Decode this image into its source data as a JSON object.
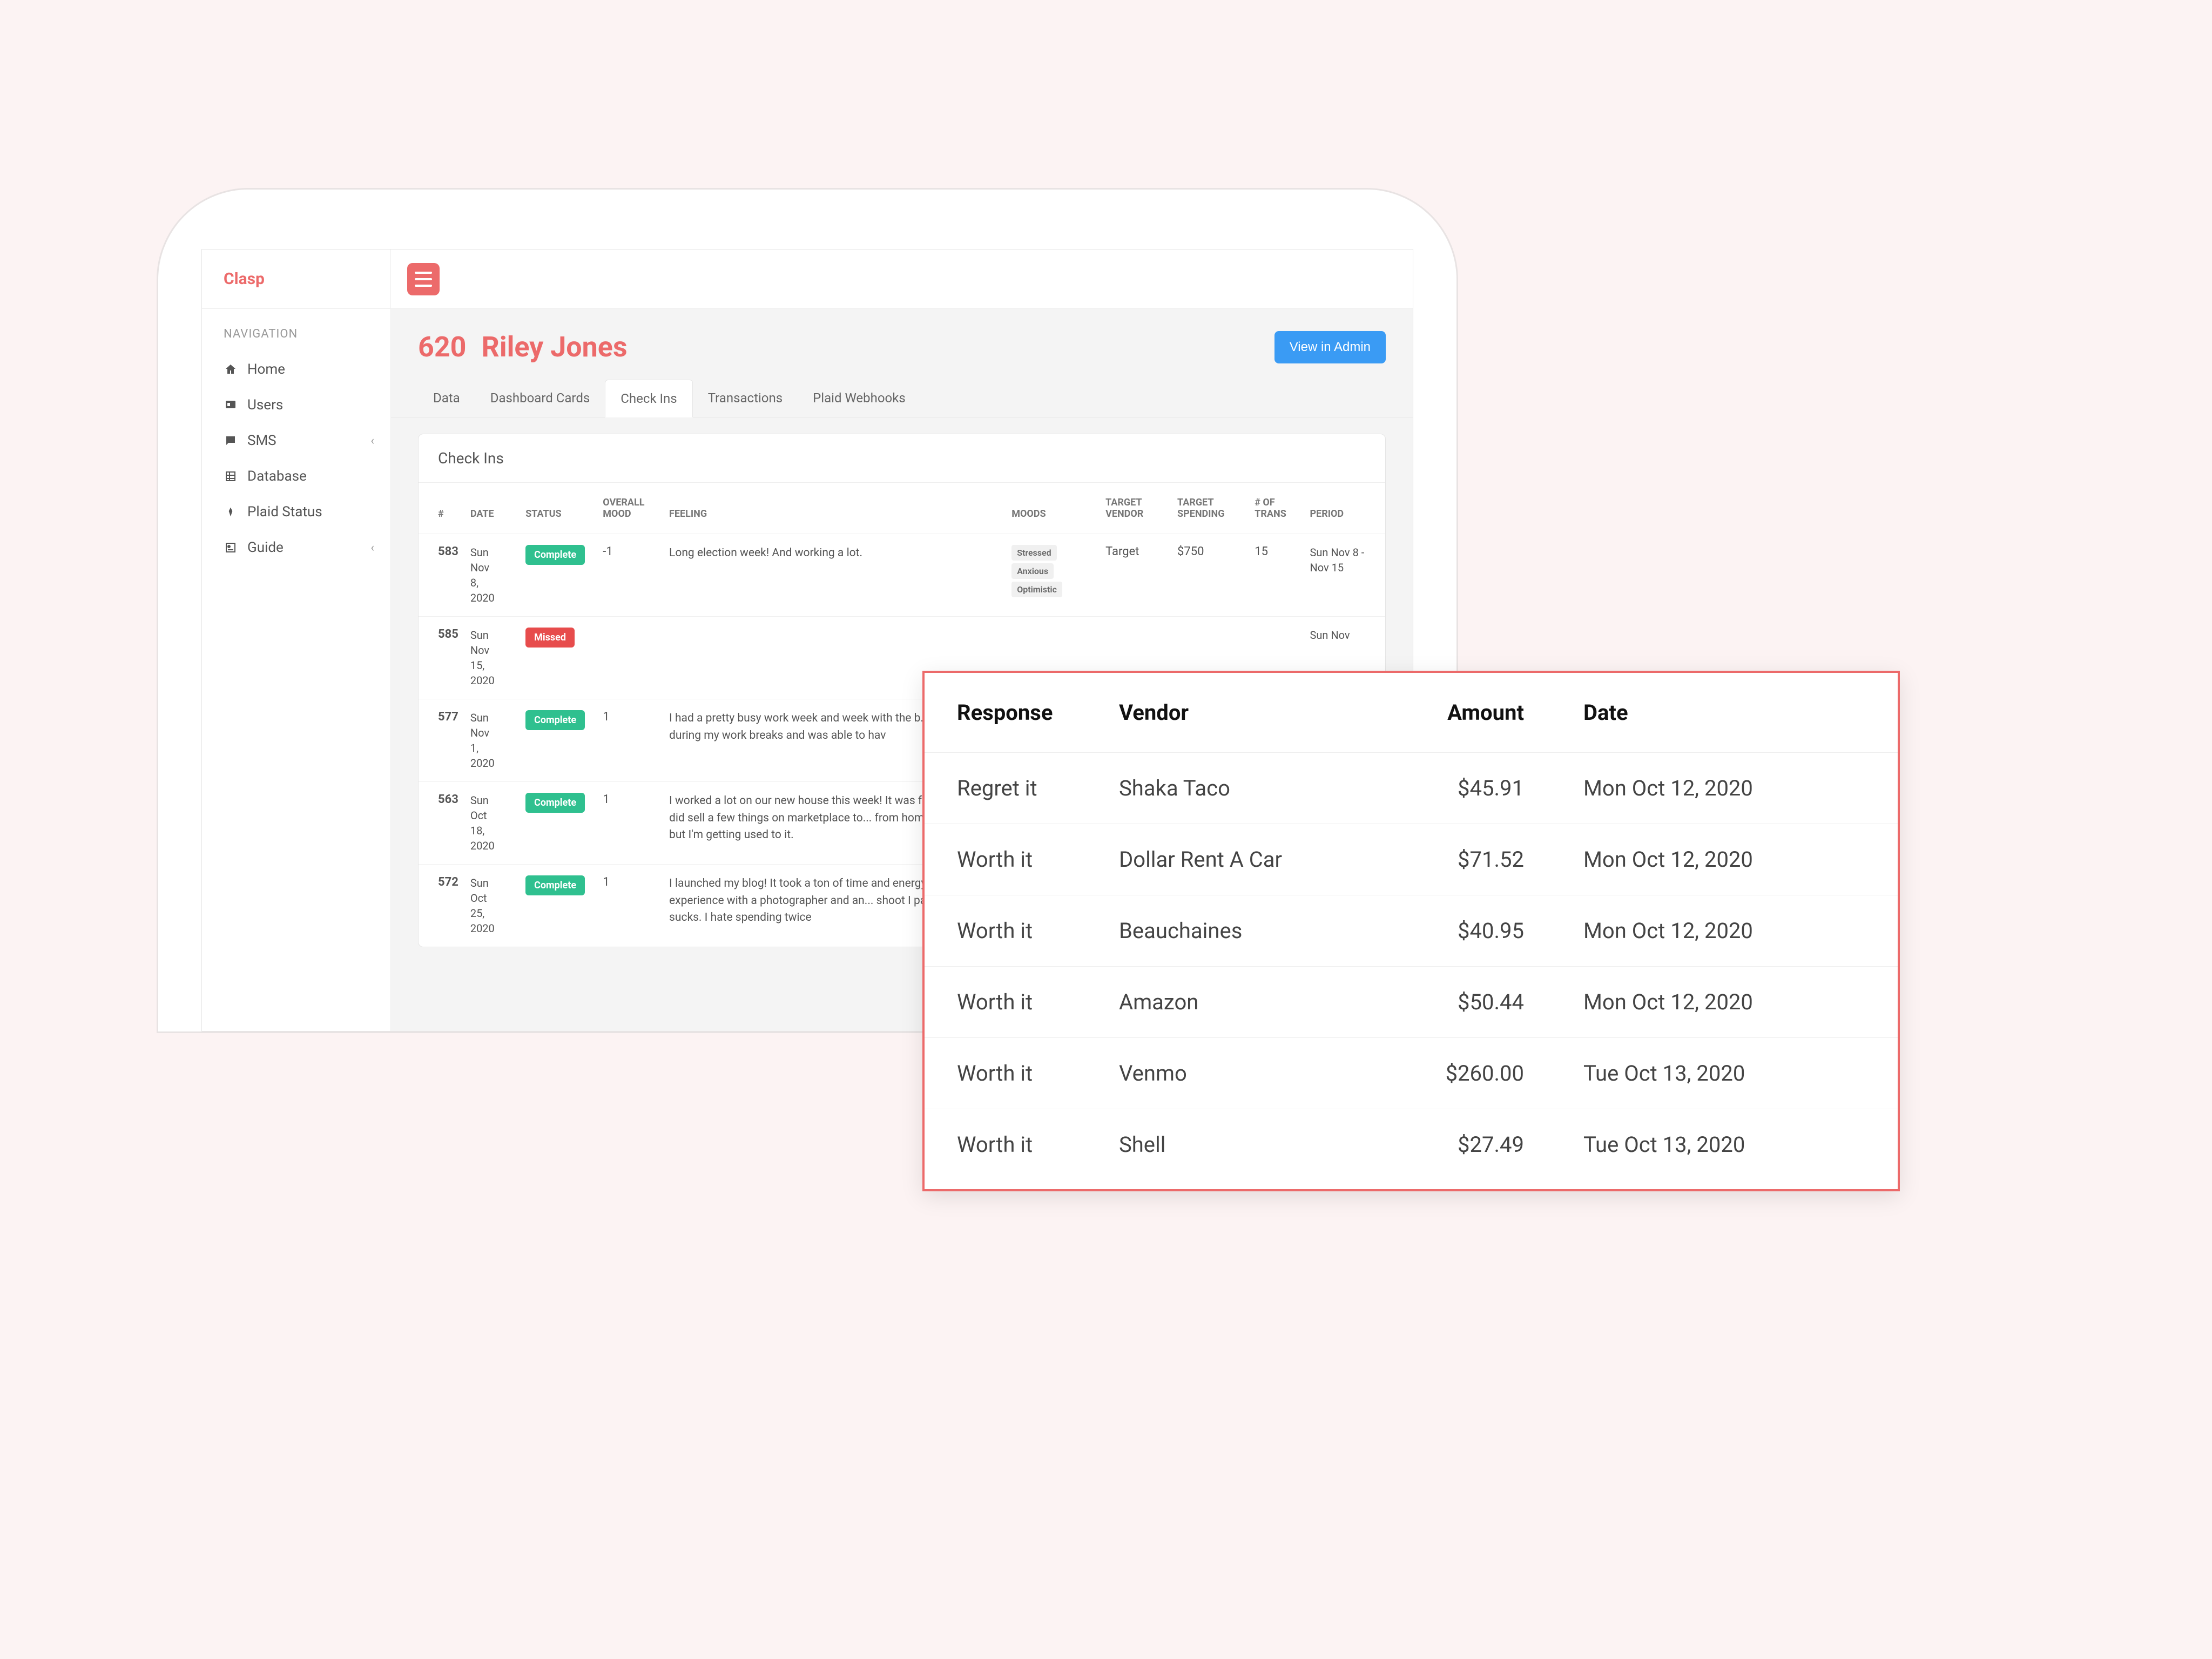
{
  "brand": "Clasp",
  "nav": {
    "heading": "NAVIGATION",
    "items": [
      {
        "label": "Home",
        "icon": "home"
      },
      {
        "label": "Users",
        "icon": "users"
      },
      {
        "label": "SMS",
        "icon": "sms",
        "chevron": true
      },
      {
        "label": "Database",
        "icon": "database"
      },
      {
        "label": "Plaid Status",
        "icon": "plaid"
      },
      {
        "label": "Guide",
        "icon": "guide",
        "chevron": true
      }
    ]
  },
  "page": {
    "id": "620",
    "name": "Riley Jones",
    "view_admin": "View in Admin"
  },
  "tabs": [
    "Data",
    "Dashboard Cards",
    "Check Ins",
    "Transactions",
    "Plaid Webhooks"
  ],
  "active_tab": "Check Ins",
  "panel_title": "Check Ins",
  "checkins": {
    "headers": {
      "id": "#",
      "date": "DATE",
      "status": "STATUS",
      "overall_mood": "OVERALL MOOD",
      "feeling": "FEELING",
      "moods": "MOODS",
      "target_vendor": "TARGET VENDOR",
      "target_spending": "TARGET SPENDING",
      "num_trans": "# OF TRANS",
      "period": "PERIOD"
    },
    "rows": [
      {
        "id": "583",
        "date": "Sun Nov 8, 2020",
        "status": "Complete",
        "status_kind": "complete",
        "overall_mood": "-1",
        "feeling": "Long election week! And working a lot.",
        "moods": [
          "Stressed",
          "Anxious",
          "Optimistic"
        ],
        "target_vendor": "Target",
        "target_spending": "$750",
        "num_trans": "15",
        "period": "Sun Nov 8 - Nov 15"
      },
      {
        "id": "585",
        "date": "Sun Nov 15, 2020",
        "status": "Missed",
        "status_kind": "missed",
        "overall_mood": "",
        "feeling": "",
        "moods": [],
        "target_vendor": "",
        "target_spending": "",
        "num_trans": "",
        "period": "Sun Nov"
      },
      {
        "id": "577",
        "date": "Sun Nov 1, 2020",
        "status": "Complete",
        "status_kind": "complete",
        "overall_mood": "1",
        "feeling": "I had a pretty busy work week and week with the b... house during my work breaks and was able to hav",
        "moods": [],
        "target_vendor": "",
        "target_spending": "",
        "num_trans": "",
        "period": ""
      },
      {
        "id": "563",
        "date": "Sun Oct 18, 2020",
        "status": "Complete",
        "status_kind": "complete",
        "overall_mood": "1",
        "feeling": "I worked a lot on our new house this week! It was f... needed to. I did sell a few things on marketplace to... from home is difficult but I'm getting used to it.",
        "moods": [],
        "target_vendor": "",
        "target_spending": "",
        "num_trans": "",
        "period": ""
      },
      {
        "id": "572",
        "date": "Sun Oct 25, 2020",
        "status": "Complete",
        "status_kind": "complete",
        "overall_mood": "1",
        "feeling": "I launched my blog! It took a ton of time and energy... have a bad experience with a photographer and an... shoot I paid for, which sucks. I hate spending twice",
        "moods": [],
        "target_vendor": "",
        "target_spending": "",
        "num_trans": "",
        "period": ""
      }
    ]
  },
  "overlay": {
    "headers": {
      "response": "Response",
      "vendor": "Vendor",
      "amount": "Amount",
      "date": "Date"
    },
    "rows": [
      {
        "response": "Regret it",
        "vendor": "Shaka Taco",
        "amount": "$45.91",
        "date": "Mon Oct 12, 2020"
      },
      {
        "response": "Worth it",
        "vendor": "Dollar Rent A Car",
        "amount": "$71.52",
        "date": "Mon Oct 12, 2020"
      },
      {
        "response": "Worth it",
        "vendor": "Beauchaines",
        "amount": "$40.95",
        "date": "Mon Oct 12, 2020"
      },
      {
        "response": "Worth it",
        "vendor": "Amazon",
        "amount": "$50.44",
        "date": "Mon Oct 12, 2020"
      },
      {
        "response": "Worth it",
        "vendor": "Venmo",
        "amount": "$260.00",
        "date": "Tue Oct 13, 2020"
      },
      {
        "response": "Worth it",
        "vendor": "Shell",
        "amount": "$27.49",
        "date": "Tue Oct 13, 2020"
      }
    ]
  }
}
